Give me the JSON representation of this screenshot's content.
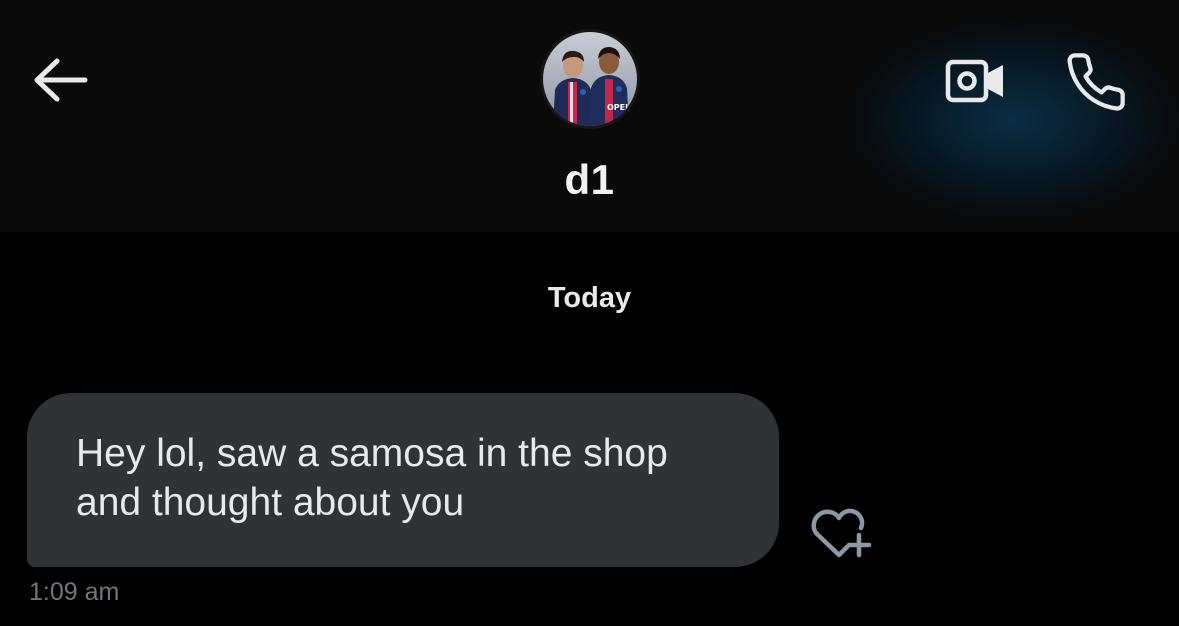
{
  "header": {
    "contact_name": "d1",
    "avatar_jersey_text": "OPEL",
    "accent_glow_color": "#0a3048",
    "icons": {
      "back": "arrow-left-icon",
      "video": "video-camera-icon",
      "call": "phone-icon"
    }
  },
  "conversation": {
    "date_separator": "Today",
    "messages": [
      {
        "text": "Hey lol, saw a samosa in the shop and thought about you",
        "time": "1:09 am",
        "bubble_color": "#2f3336",
        "reaction_icon": "heart-plus-icon"
      }
    ]
  }
}
